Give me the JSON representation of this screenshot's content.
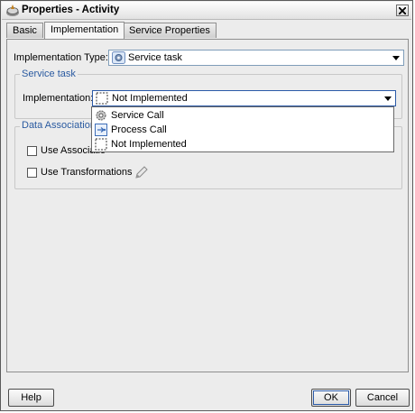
{
  "window": {
    "title": "Properties - Activity"
  },
  "tabs": [
    {
      "label": "Basic",
      "active": false
    },
    {
      "label": "Implementation",
      "active": true
    },
    {
      "label": "Service Properties",
      "active": false
    }
  ],
  "implementation_type": {
    "label": "Implementation Type:",
    "value": "Service task",
    "icon": "service-task-gear-icon"
  },
  "service_task_group": {
    "title": "Service task",
    "implementation_label": "Implementation:",
    "implementation_value": "Not Implemented"
  },
  "implementation_dropdown": {
    "options": [
      {
        "label": "Service Call",
        "icon": "gear-icon"
      },
      {
        "label": "Process Call",
        "icon": "process-call-icon"
      },
      {
        "label": "Not Implemented",
        "icon": "dashed-box-icon"
      }
    ]
  },
  "data_associations": {
    "title": "Data Associations",
    "use_associations_label": "Use Associatio",
    "use_associations_checked": false,
    "use_transformations_label": "Use Transformations",
    "use_transformations_checked": false
  },
  "footer": {
    "help_label": "Help",
    "ok_label": "OK",
    "cancel_label": "Cancel"
  },
  "colors": {
    "accent": "#2a5aa0",
    "selection_border": "#2b5aa8"
  }
}
